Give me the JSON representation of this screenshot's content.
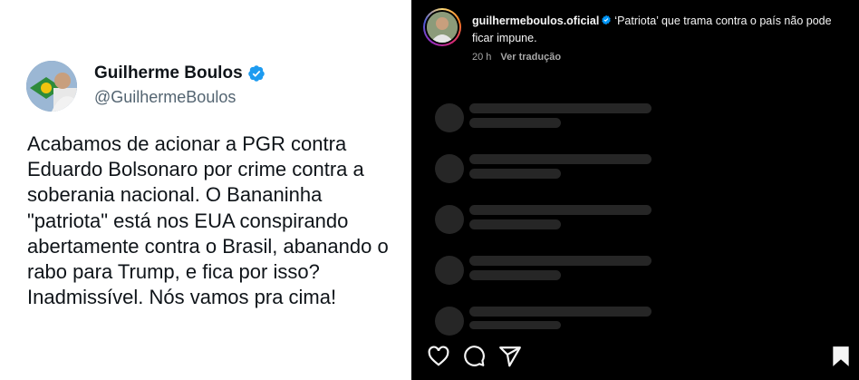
{
  "tweet": {
    "name": "Guilherme Boulos",
    "handle": "@GuilhermeBoulos",
    "body": "Acabamos de acionar a PGR contra Eduardo Bolsonaro por crime contra a soberania nacional. O Bananinha \"patriota\" está nos EUA conspirando abertamente contra o Brasil, abanando o rabo para Trump, e fica por isso? Inadmissível. Nós vamos pra cima!",
    "verified_color": "#1d9bf0"
  },
  "instagram": {
    "username": "guilhermeboulos.oficial",
    "caption": "‘Patriota’ que trama contra o país não pode ficar impune.",
    "time": "20 h",
    "translate_label": "Ver tradução",
    "verified_color": "#0095f6",
    "icons": [
      "heart-icon",
      "comment-icon",
      "share-icon",
      "bookmark-icon"
    ]
  }
}
